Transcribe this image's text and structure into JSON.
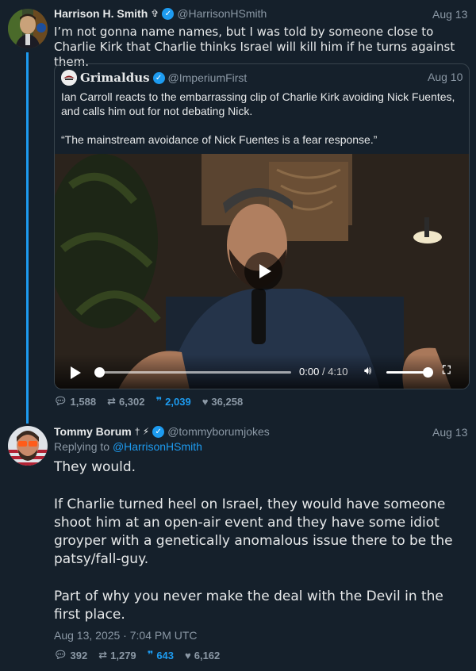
{
  "tweet1": {
    "author_name": "Harrison H. Smith",
    "author_emoji": "✞",
    "handle": "@HarrisonHSmith",
    "date": "Aug 13",
    "text": "I’m not gonna name names, but I was told by someone close to Charlie Kirk that Charlie thinks Israel will kill him if he turns against them.",
    "quoted": {
      "author_name": "Grimaldus",
      "handle": "@ImperiumFirst",
      "date": "Aug 10",
      "paragraphs": [
        "Ian Carroll reacts to the embarrassing clip of Charlie Kirk avoiding Nick Fuentes, and calls him out for not debating Nick.",
        "“The mainstream avoidance of Nick Fuentes is a fear response.”"
      ],
      "video": {
        "current_time": "0:00",
        "separator": "/",
        "duration": "4:10",
        "progress_fraction": 0
      }
    },
    "stats": {
      "replies": "1,588",
      "retweets": "6,302",
      "quotes": "2,039",
      "likes": "36,258"
    }
  },
  "tweet2": {
    "author_name": "Tommy Borum",
    "author_emoji": "† ⚡",
    "handle": "@tommyborumjokes",
    "date": "Aug 13",
    "replying_label": "Replying to",
    "replying_to": "@HarrisonHSmith",
    "paragraphs": [
      "They would.",
      "If Charlie turned heel on Israel, they would have someone shoot him at an open-air event and they have some idiot groyper with a genetically anomalous issue there to be the patsy/fall-guy.",
      "Part of why you never make the deal with the Devil in the first place."
    ],
    "timestamp": "Aug 13, 2025 · 7:04 PM UTC",
    "stats": {
      "replies": "392",
      "retweets": "1,279",
      "quotes": "643",
      "likes": "6,162"
    }
  },
  "icons": {
    "verified": "verified-badge-icon",
    "reply": "comment-icon",
    "retweet": "retweet-icon",
    "quote": "quote-icon",
    "like": "heart-icon",
    "play": "play-icon",
    "volume": "volume-icon",
    "fullscreen": "fullscreen-icon"
  },
  "colors": {
    "background": "#15202b",
    "accent": "#1d9bf0",
    "muted": "#8b98a5",
    "text": "#e7e9ea"
  }
}
